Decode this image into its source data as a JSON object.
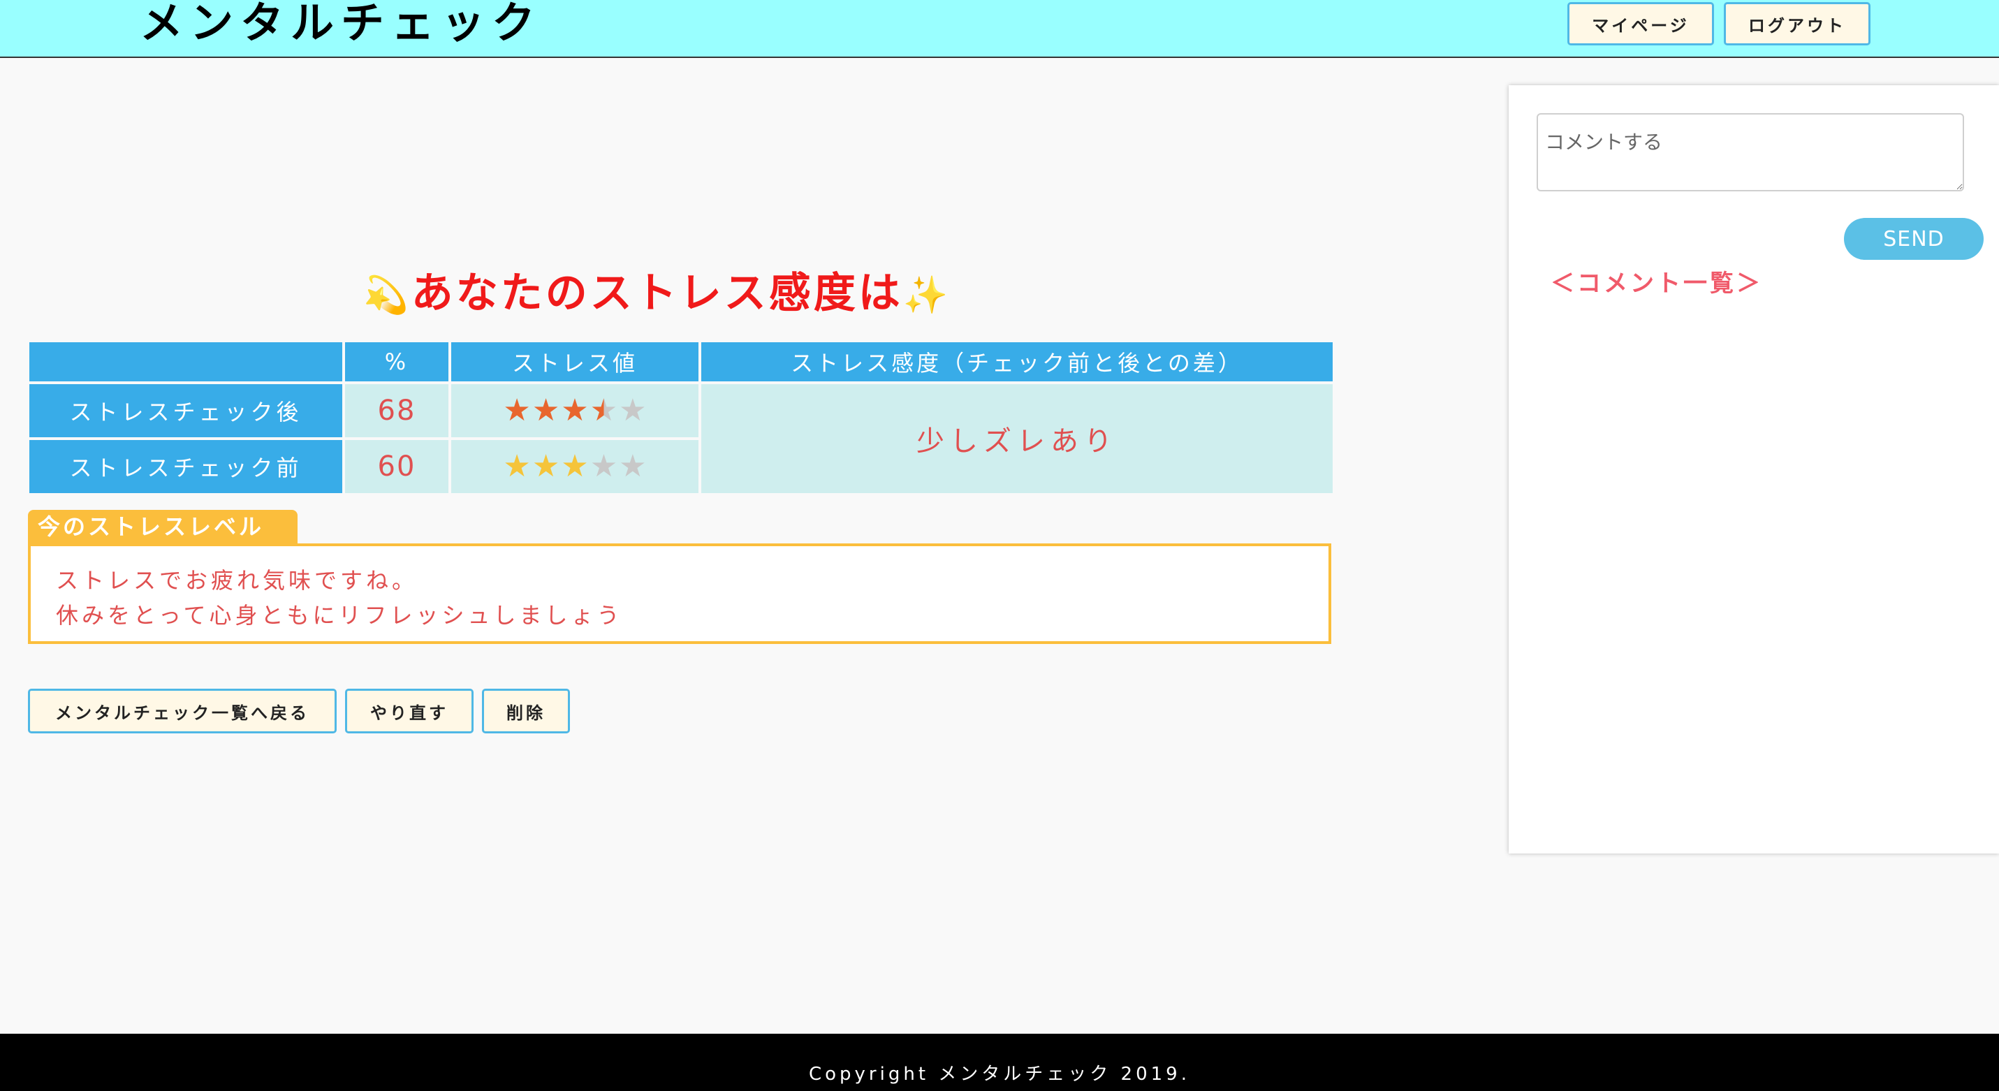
{
  "header": {
    "logo": "メンタルチェック",
    "mypage_label": "マイページ",
    "logout_label": "ログアウト",
    "background": "#99ffff"
  },
  "result": {
    "title_prefix_emoji": "💫",
    "title": "あなたのストレス感度は",
    "title_suffix_emoji": "✨",
    "table": {
      "headers": [
        "",
        "%",
        "ストレス値",
        "ストレス感度（チェック前と後との差）"
      ],
      "rows": [
        {
          "label": "ストレスチェック後",
          "percent": "68",
          "stars": 3.5,
          "star_color": "#e8662e"
        },
        {
          "label": "ストレスチェック前",
          "percent": "60",
          "stars": 3,
          "star_color": "#f5c43a"
        }
      ],
      "difference": "少しズレあり",
      "max_stars": 5
    }
  },
  "level": {
    "tab_label": "今のストレスレベル",
    "lines": [
      "ストレスでお疲れ気味ですね。",
      "休みをとって心身ともにリフレッシュしましょう"
    ]
  },
  "actions": {
    "back_label": "メンタルチェック一覧へ戻る",
    "redo_label": "やり直す",
    "delete_label": "削除"
  },
  "comments": {
    "placeholder": "コメントする",
    "send_label": "SEND",
    "list_title": "＜コメント一覧＞"
  },
  "footer": {
    "copyright": "Copyright メンタルチェック 2019."
  },
  "icons": {
    "star_filled": "★",
    "star_empty": "★"
  }
}
